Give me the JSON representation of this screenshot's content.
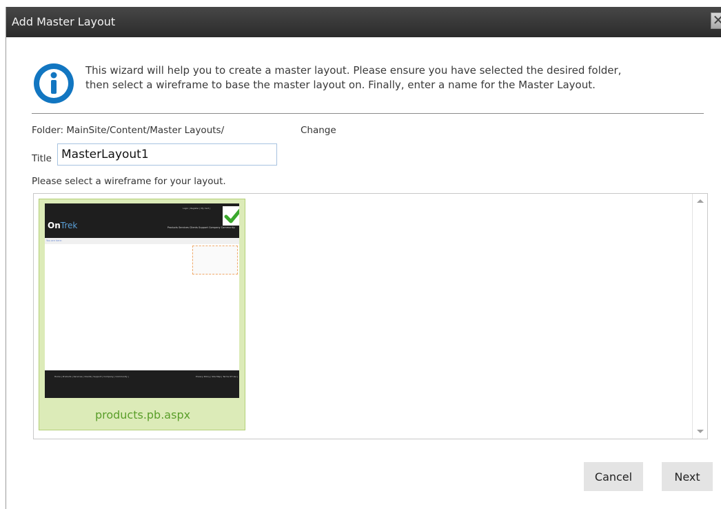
{
  "dialog": {
    "title": "Add Master Layout",
    "close_icon": "close-icon",
    "info_icon": "info-icon",
    "intro_line1": "This wizard will help you to create a master layout. Please ensure you have selected the desired folder,",
    "intro_line2": "then select a wireframe to base the master layout on. Finally, enter a name for the Master Layout.",
    "folder_label": "Folder: MainSite/Content/Master Layouts/",
    "change_label": "Change",
    "title_label": "Title",
    "title_value": "MasterLayout1",
    "select_label": "Please select a wireframe for your layout.",
    "wireframes": [
      {
        "name": "products.pb.aspx",
        "selected": true,
        "thumb_logo_a": "On",
        "thumb_logo_b": "Trek",
        "thumb_toplinks": "Login | Register | My Cart |",
        "thumb_menu": "Products  Services  Clients  Support  Company  Community",
        "thumb_crumb": "You are here:",
        "thumb_footer_left": "Home | Products | Services | Clients | Support | Company | Community |",
        "thumb_footer_right": "Privacy Policy | Site Map | Terms Of Use |"
      }
    ],
    "cancel_label": "Cancel",
    "next_label": "Next",
    "colors": {
      "titlebar": "#2b2b2b",
      "accent_green": "#5a9e2a",
      "selection_bg": "#dcebb8",
      "info_blue": "#1276c1"
    }
  }
}
